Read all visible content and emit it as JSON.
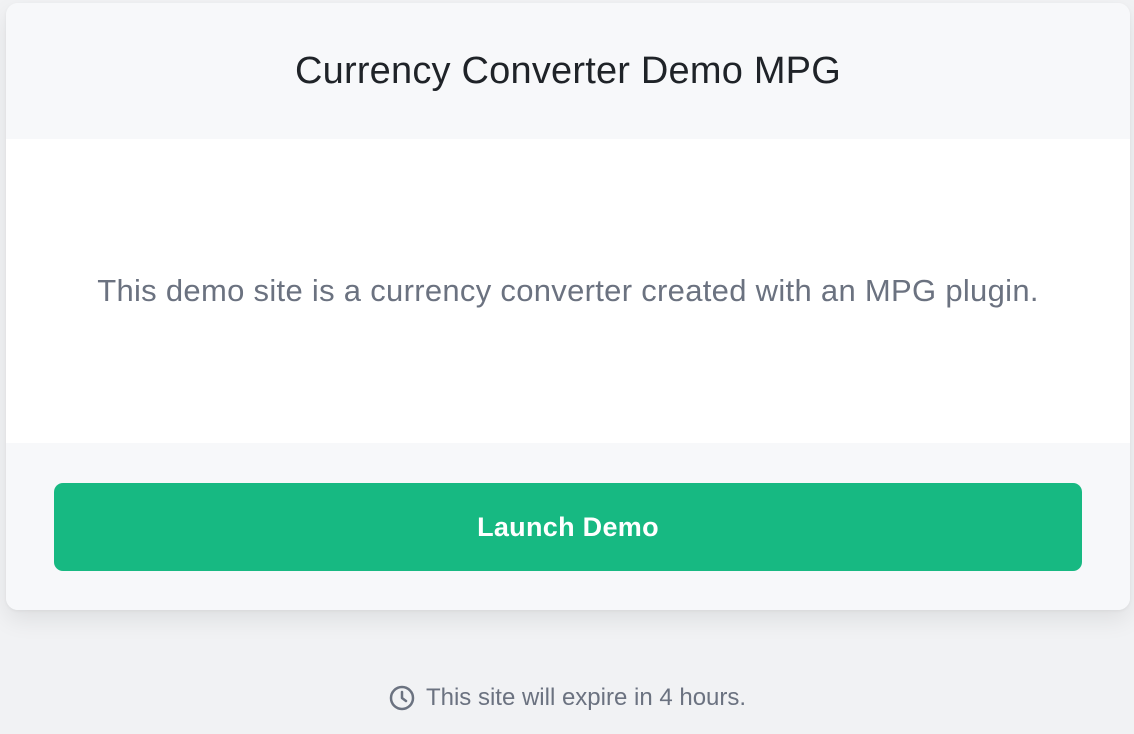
{
  "card": {
    "title": "Currency Converter Demo MPG",
    "description": "This demo site is a currency converter created with an MPG plugin.",
    "launch_label": "Launch Demo"
  },
  "footer": {
    "expiry_text": "This site will expire in 4 hours.",
    "icon": "clock-icon"
  },
  "colors": {
    "accent": "#17b982",
    "page_background": "#f1f2f4",
    "card_background": "#f7f8fa",
    "title_text": "#1f2328",
    "muted_text": "#6b7280"
  }
}
